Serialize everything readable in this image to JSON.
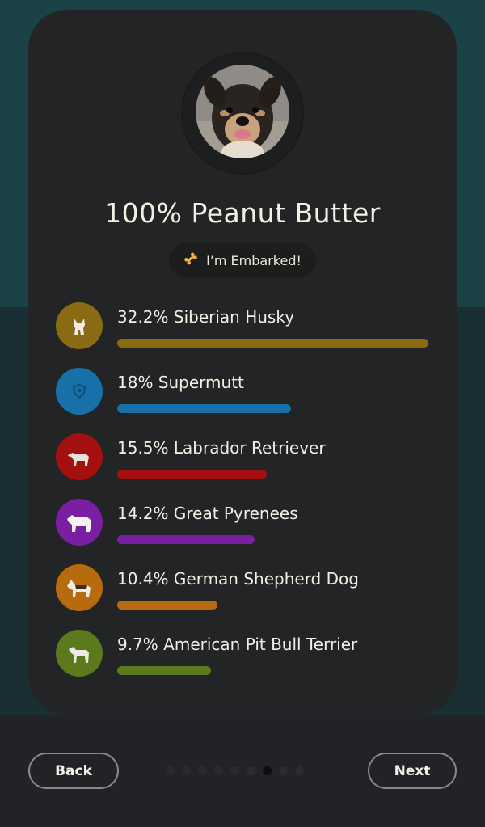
{
  "profile": {
    "title": "100% Peanut Butter",
    "badge_label": "I’m Embarked!",
    "badge_icon": "bone-icon"
  },
  "breeds": [
    {
      "label": "32.2% Siberian Husky",
      "percent": 32.2,
      "color": "#8a6b13"
    },
    {
      "label": "18% Supermutt",
      "percent": 18,
      "color": "#1770a8"
    },
    {
      "label": "15.5% Labrador Retriever",
      "percent": 15.5,
      "color": "#a40f0f"
    },
    {
      "label": "14.2% Great Pyrenees",
      "percent": 14.2,
      "color": "#7a1fa3"
    },
    {
      "label": "10.4% German Shepherd Dog",
      "percent": 10.4,
      "color": "#b86a0e"
    },
    {
      "label": "9.7% American Pit Bull Terrier",
      "percent": 9.7,
      "color": "#5b7a1e"
    }
  ],
  "nav": {
    "back_label": "Back",
    "next_label": "Next",
    "page_count": 9,
    "current_page": 7
  }
}
